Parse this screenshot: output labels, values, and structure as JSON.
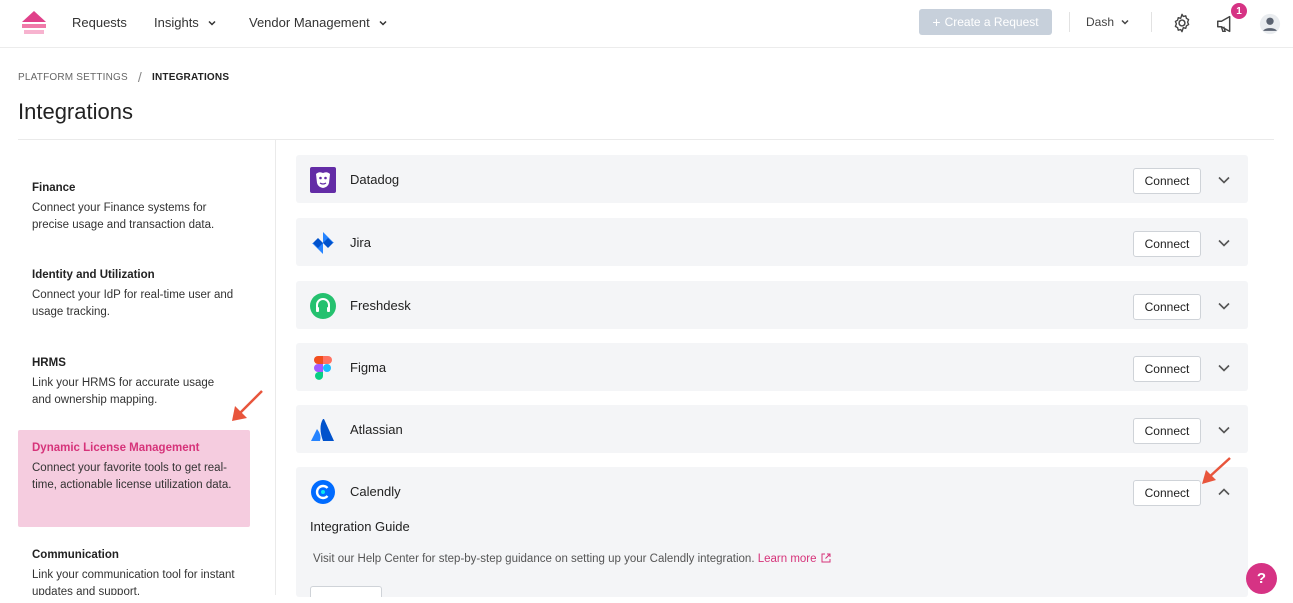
{
  "nav": {
    "requests": "Requests",
    "insights": "Insights",
    "vendor_management": "Vendor Management",
    "create_request": "Create a Request",
    "user": "Dash",
    "notification_count": "1"
  },
  "breadcrumb": {
    "parent": "PLATFORM SETTINGS",
    "separator": "/",
    "current": "INTEGRATIONS"
  },
  "page_title": "Integrations",
  "sidebar": {
    "items": [
      {
        "title": "Finance",
        "desc": "Connect your Finance systems for precise usage and transaction data."
      },
      {
        "title": "Identity and Utilization",
        "desc": "Connect your IdP for real-time user and usage tracking."
      },
      {
        "title": "HRMS",
        "desc": "Link your HRMS for accurate usage and ownership mapping."
      },
      {
        "title": "Dynamic License Management",
        "desc": "Connect your favorite tools to get real-time, actionable license utilization data."
      },
      {
        "title": "Communication",
        "desc": "Link your communication tool for instant updates and support."
      }
    ]
  },
  "integrations": [
    {
      "name": "Datadog",
      "button": "Connect"
    },
    {
      "name": "Jira",
      "button": "Connect"
    },
    {
      "name": "Freshdesk",
      "button": "Connect"
    },
    {
      "name": "Figma",
      "button": "Connect"
    },
    {
      "name": "Atlassian",
      "button": "Connect"
    },
    {
      "name": "Calendly",
      "button": "Connect"
    }
  ],
  "guide": {
    "title": "Integration Guide",
    "text": "Visit our Help Center for step-by-step guidance on setting up your Calendly integration.",
    "link": "Learn more"
  },
  "help_label": "?",
  "colors": {
    "accent": "#d63384",
    "active_bg": "#f5ccdf",
    "row_bg": "#f4f5f7",
    "create_btn": "#c7d0db",
    "annotation_arrow": "#e8553c"
  }
}
